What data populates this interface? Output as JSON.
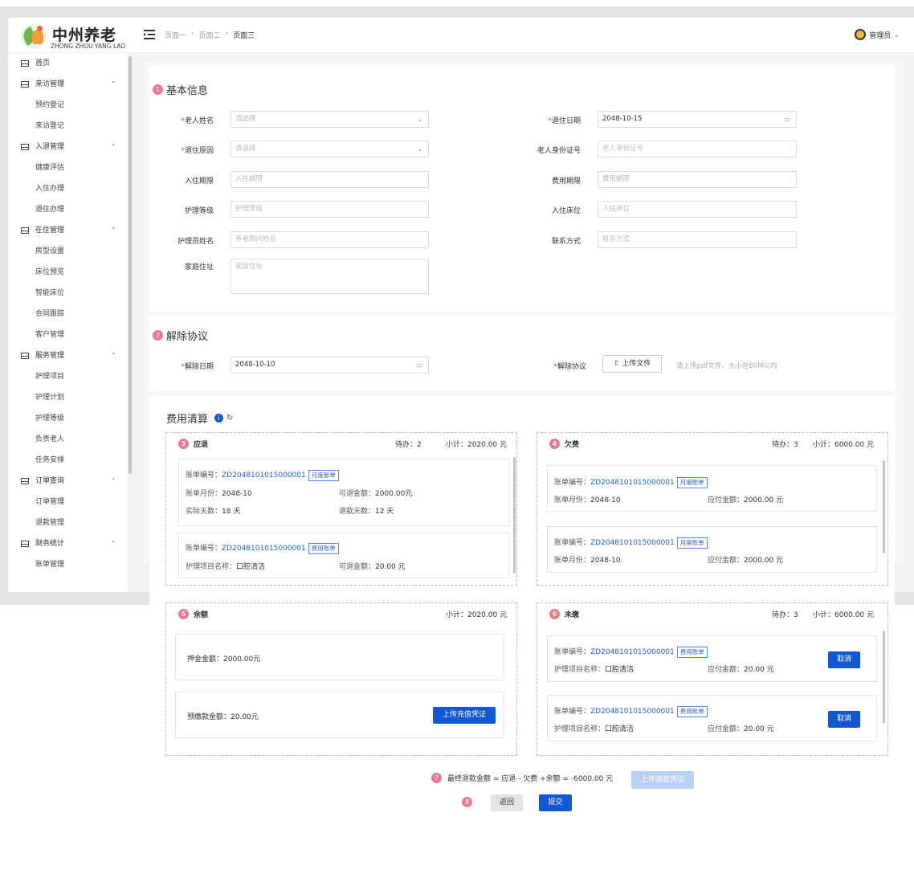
{
  "header": {
    "logo_cn": "中州养老",
    "logo_en": "ZHONG ZHOU YANG LAO",
    "breadcrumb": [
      "页面一",
      "页面二",
      "页面三"
    ],
    "user": "管理员"
  },
  "sidebar": {
    "items": [
      {
        "type": "group",
        "label": "首页",
        "chevron": false
      },
      {
        "type": "group",
        "label": "来访管理",
        "chevron": true
      },
      {
        "type": "sub",
        "label": "预约登记"
      },
      {
        "type": "sub",
        "label": "来访登记"
      },
      {
        "type": "group",
        "label": "入退管理",
        "chevron": true
      },
      {
        "type": "sub",
        "label": "健康评估"
      },
      {
        "type": "sub",
        "label": "入住办理"
      },
      {
        "type": "sub",
        "label": "退住办理"
      },
      {
        "type": "group",
        "label": "在住管理",
        "chevron": true
      },
      {
        "type": "sub",
        "label": "房型设置"
      },
      {
        "type": "sub",
        "label": "床位预览"
      },
      {
        "type": "sub",
        "label": "智能床位"
      },
      {
        "type": "sub",
        "label": "合同跟踪"
      },
      {
        "type": "sub",
        "label": "客户管理"
      },
      {
        "type": "group",
        "label": "服务管理",
        "chevron": true
      },
      {
        "type": "sub",
        "label": "护理项目"
      },
      {
        "type": "sub",
        "label": "护理计划"
      },
      {
        "type": "sub",
        "label": "护理等级"
      },
      {
        "type": "sub",
        "label": "负责老人"
      },
      {
        "type": "sub",
        "label": "任务安排"
      },
      {
        "type": "group",
        "label": "订单查询",
        "chevron": true
      },
      {
        "type": "sub",
        "label": "订单管理"
      },
      {
        "type": "sub",
        "label": "退款管理"
      },
      {
        "type": "group",
        "label": "财务统计",
        "chevron": true
      },
      {
        "type": "sub",
        "label": "账单管理"
      }
    ]
  },
  "basic": {
    "num": "1",
    "title": "基本信息",
    "elder_name": {
      "label": "老人姓名",
      "placeholder": "请选择"
    },
    "checkout_date": {
      "label": "退住日期",
      "value": "2048-10-15"
    },
    "reason": {
      "label": "退住原因",
      "placeholder": "请选择"
    },
    "id_card": {
      "label": "老人身份证号",
      "placeholder": "老人身份证号"
    },
    "stay_period": {
      "label": "入住期限",
      "placeholder": "入住期限"
    },
    "fee_period": {
      "label": "费用期限",
      "placeholder": "费用期限"
    },
    "care_level": {
      "label": "护理等级",
      "placeholder": "护理等级"
    },
    "bed": {
      "label": "入住床位",
      "placeholder": "入住床位"
    },
    "caregiver": {
      "label": "护理员姓名",
      "placeholder": "养老顾问姓名"
    },
    "contact": {
      "label": "联系方式",
      "placeholder": "联系方式"
    },
    "address": {
      "label": "家庭住址",
      "placeholder": "家庭住址"
    }
  },
  "termination": {
    "num": "2",
    "title": "解除协议",
    "date": {
      "label": "解除日期",
      "value": "2048-10-10"
    },
    "agreement": {
      "label": "解除协议",
      "button": "上传文件",
      "hint": "请上传pdf文件，大小在60M以内"
    }
  },
  "settlement": {
    "title": "费用清算",
    "refund": {
      "num": "3",
      "title": "应退",
      "pending": "待办：2",
      "subtotal": "小计：2020.00 元",
      "bills": [
        {
          "no_label": "账单编号：",
          "no": "ZD2048101015000001",
          "tag": "月度账单",
          "l1_k": "账单月份：",
          "l1_v": "2048-10",
          "r1_k": "可退金额：",
          "r1_v": "2000.00元",
          "l2_k": "实际天数：",
          "l2_v": "18 天",
          "r2_k": "退款天数：",
          "r2_v": "12 天"
        },
        {
          "no_label": "账单编号：",
          "no": "ZD2048101015000001",
          "tag": "费用账单",
          "l1_k": "护理项目名称：",
          "l1_v": "口腔清洁",
          "r1_k": "可退金额：",
          "r1_v": "20.00 元"
        }
      ]
    },
    "arrears": {
      "num": "4",
      "title": "欠费",
      "pending": "待办：3",
      "subtotal": "小计：6000.00 元",
      "bills": [
        {
          "no_label": "账单编号：",
          "no": "ZD2048101015000001",
          "tag": "月度账单",
          "l1_k": "账单月份：",
          "l1_v": "2048-10",
          "r1_k": "应付金额：",
          "r1_v": "2000.00 元"
        },
        {
          "no_label": "账单编号：",
          "no": "ZD2048101015000001",
          "tag": "月度账单",
          "l1_k": "账单月份：",
          "l1_v": "2048-10",
          "r1_k": "应付金额：",
          "r1_v": "2000.00 元"
        }
      ]
    },
    "balance": {
      "num": "5",
      "title": "余额",
      "subtotal": "小计：2020.00 元",
      "deposit": "押金金额：2000.00元",
      "prepaid": "预缴款金额：20.00元",
      "upload_btn": "上传充值凭证"
    },
    "unpaid": {
      "num": "6",
      "title": "未缴",
      "pending": "待办：3",
      "subtotal": "小计：6000.00 元",
      "bills": [
        {
          "no_label": "账单编号：",
          "no": "ZD2048101015000001",
          "tag": "费用账单",
          "l1_k": "护理项目名称：",
          "l1_v": "口腔清洁",
          "r1_k": "应付金额：",
          "r1_v": "20.00 元",
          "btn": "取消"
        },
        {
          "no_label": "账单编号：",
          "no": "ZD2048101015000001",
          "tag": "费用账单",
          "l1_k": "护理项目名称：",
          "l1_v": "口腔清洁",
          "r1_k": "应付金额：",
          "r1_v": "20.00 元",
          "btn": "取消"
        }
      ]
    },
    "final": {
      "num": "7",
      "formula": "最终退款金额 = 应退 - 欠费 +余额 = -6000.00 元",
      "upload_btn": "上传退款凭证"
    },
    "actions": {
      "num": "8",
      "back": "返回",
      "submit": "提交"
    }
  },
  "colors": {
    "primary": "#1257d4",
    "badge": "#e87a8a",
    "link": "#1f5fd8"
  }
}
